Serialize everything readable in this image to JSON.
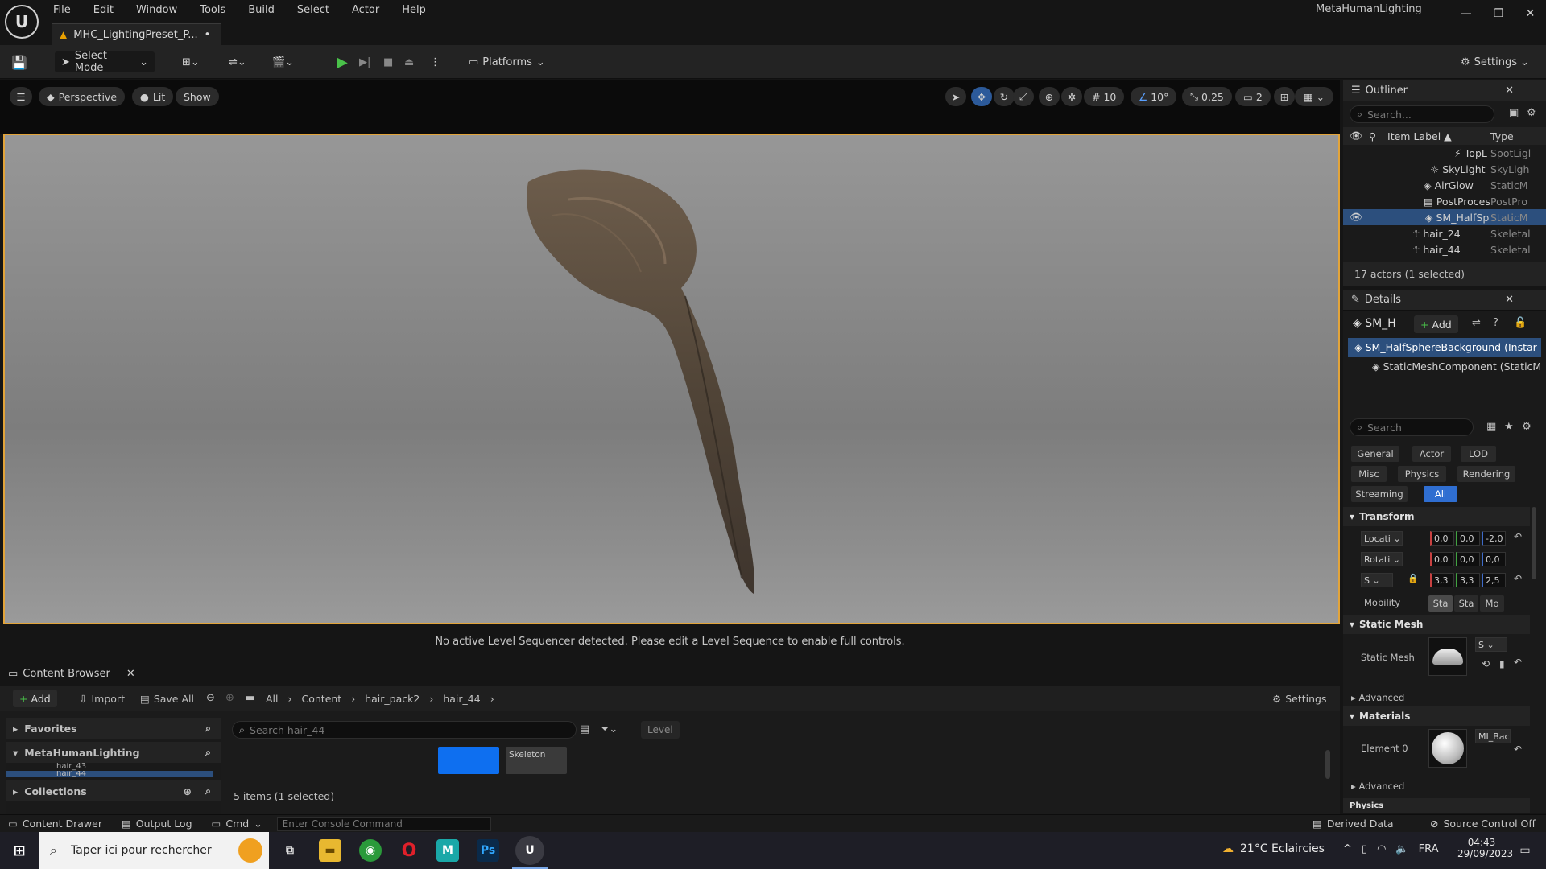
{
  "app": {
    "project": "MetaHumanLighting",
    "doc_tab": "MHC_LightingPreset_P...",
    "doc_dirty": "•"
  },
  "menu": [
    "File",
    "Edit",
    "Window",
    "Tools",
    "Build",
    "Select",
    "Actor",
    "Help"
  ],
  "toolbar": {
    "select_mode": "Select Mode",
    "platforms": "Platforms",
    "settings": "Settings"
  },
  "viewport": {
    "perspective": "Perspective",
    "lit": "Lit",
    "show": "Show",
    "grid_snap": "10",
    "rot_snap": "10°",
    "scale_snap": "0,25",
    "cam_speed": "2",
    "sequencer_msg": "No active Level Sequencer detected. Please edit a Level Sequence to enable full controls."
  },
  "outliner": {
    "title": "Outliner",
    "search_placeholder": "Search...",
    "col_label": "Item Label ▲",
    "col_type": "Type",
    "rows": [
      {
        "label": "TopL",
        "type": "SpotLigl"
      },
      {
        "label": "SkyLight",
        "type": "SkyLigh"
      },
      {
        "label": "AirGlow",
        "type": "StaticM"
      },
      {
        "label": "PostProces",
        "type": "PostPro"
      },
      {
        "label": "SM_HalfSp",
        "type": "StaticM"
      },
      {
        "label": "hair_24",
        "type": "Skeletal"
      },
      {
        "label": "hair_44",
        "type": "Skeletal"
      }
    ],
    "count": "17 actors (1 selected)"
  },
  "details": {
    "title": "Details",
    "actor_short": "SM_H",
    "add": "Add",
    "component_root": "SM_HalfSphereBackground (Instar",
    "component_child": "StaticMeshComponent (StaticM",
    "search_placeholder": "Search",
    "categories": [
      "General",
      "Actor",
      "LOD",
      "Misc",
      "Physics",
      "Rendering",
      "Streaming",
      "All"
    ],
    "transform": {
      "title": "Transform",
      "location_label": "Locati",
      "location": [
        "0,0",
        "0,0",
        "-2,0"
      ],
      "rotation_label": "Rotati",
      "rotation": [
        "0,0",
        "0,0",
        "0,0"
      ],
      "scale_label": "S",
      "scale": [
        "3,3",
        "3,3",
        "2,5"
      ],
      "mobility_label": "Mobility",
      "mobility": [
        "Sta",
        "Sta",
        "Mo"
      ]
    },
    "static_mesh": {
      "title": "Static Mesh",
      "label": "Static Mesh",
      "value": "S"
    },
    "advanced": "Advanced",
    "materials": {
      "title": "Materials",
      "element": "Element 0",
      "value": "MI_Bac"
    },
    "physics_cut": "Physics"
  },
  "content_browser": {
    "tab": "Content Browser",
    "add": "Add",
    "import": "Import",
    "save_all": "Save All",
    "path": [
      "All",
      "Content",
      "hair_pack2",
      "hair_44"
    ],
    "settings": "Settings",
    "favorites": "Favorites",
    "project": "MetaHumanLighting",
    "tree": [
      "hair_43",
      "hair_44"
    ],
    "collections": "Collections",
    "search_placeholder": "Search hair_44",
    "filter_chip": "Level",
    "asset_label": "Skeleton",
    "status": "5 items (1 selected)"
  },
  "statusbar": {
    "drawer": "Content Drawer",
    "output": "Output Log",
    "cmd": "Cmd",
    "console_placeholder": "Enter Console Command",
    "derived": "Derived Data",
    "source": "Source Control Off"
  },
  "taskbar": {
    "search": "Taper ici pour rechercher",
    "weather": "21°C  Eclaircies",
    "lang": "FRA",
    "time": "04:43",
    "date": "29/09/2023"
  }
}
